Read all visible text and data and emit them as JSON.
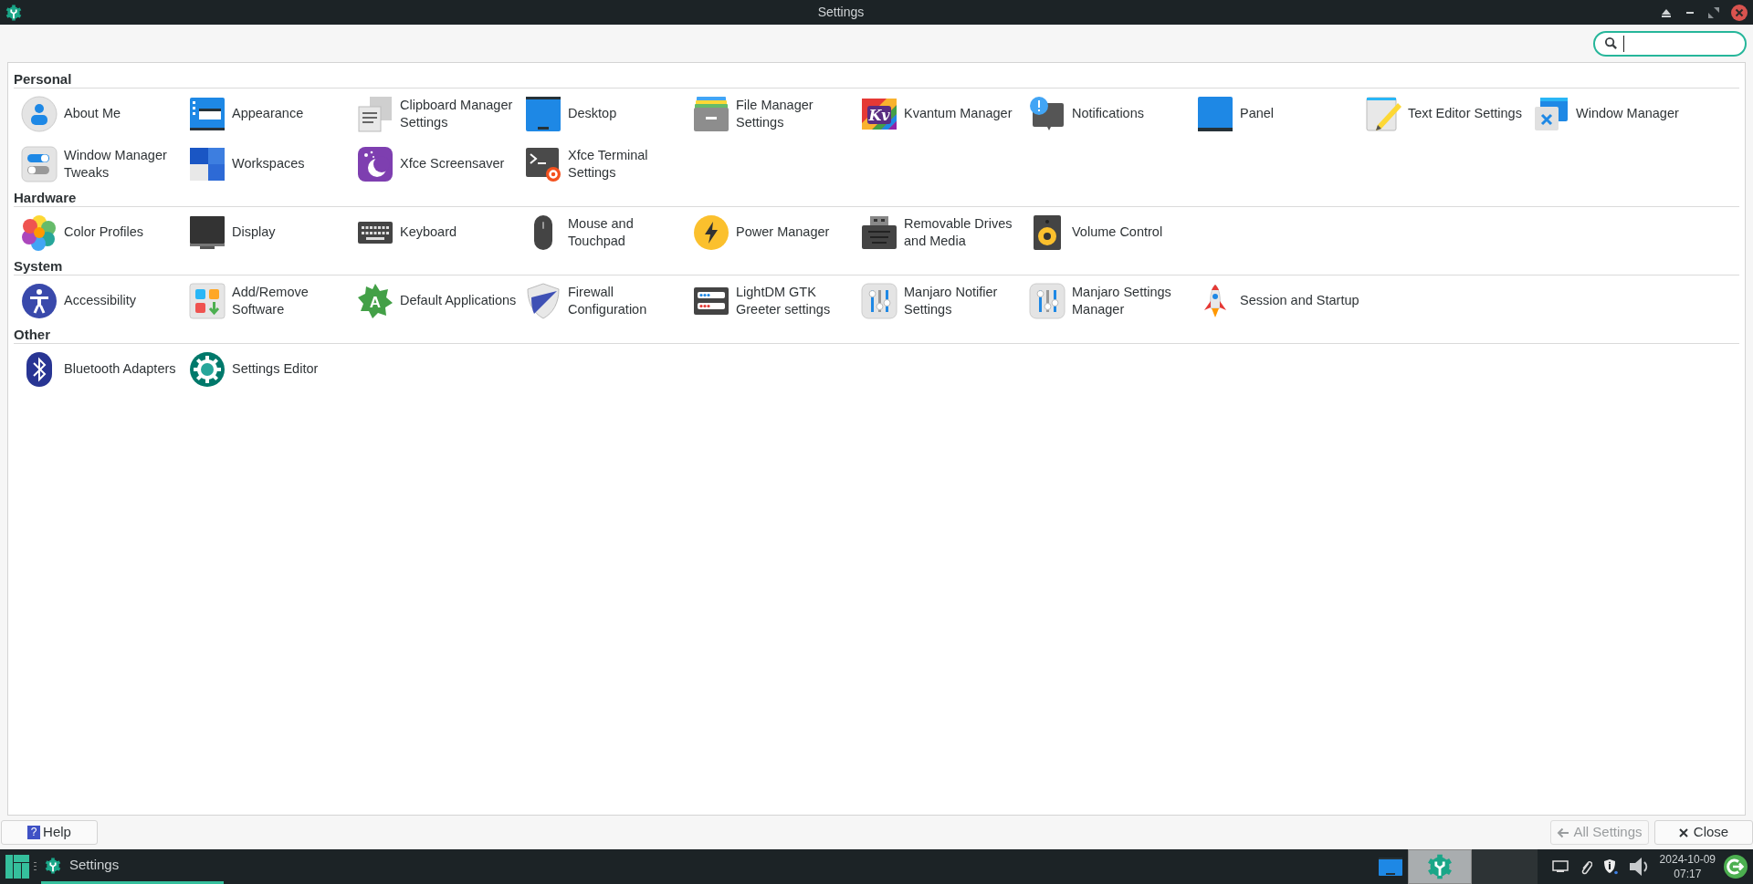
{
  "window": {
    "title": "Settings"
  },
  "search": {
    "focused": true
  },
  "sections": [
    {
      "title": "Personal",
      "items": [
        {
          "label": "About Me",
          "kind": "person"
        },
        {
          "label": "Appearance",
          "kind": "appearance"
        },
        {
          "label": "Clipboard Manager Settings",
          "kind": "clipboard"
        },
        {
          "label": "Desktop",
          "kind": "desktop"
        },
        {
          "label": "File Manager Settings",
          "kind": "filemanager"
        },
        {
          "label": "Kvantum Manager",
          "kind": "kvantum",
          "icon_text": "Kv"
        },
        {
          "label": "Notifications",
          "kind": "notification"
        },
        {
          "label": "Panel",
          "kind": "panel"
        },
        {
          "label": "Text Editor Settings",
          "kind": "texteditor"
        },
        {
          "label": "Window Manager",
          "kind": "windowmanager"
        },
        {
          "label": "Window Manager Tweaks",
          "kind": "toggles"
        },
        {
          "label": "Workspaces",
          "kind": "workspaces"
        },
        {
          "label": "Xfce Screensaver",
          "kind": "moon"
        },
        {
          "label": "Xfce Terminal Settings",
          "kind": "terminal"
        }
      ]
    },
    {
      "title": "Hardware",
      "items": [
        {
          "label": "Color Profiles",
          "kind": "colors"
        },
        {
          "label": "Display",
          "kind": "display"
        },
        {
          "label": "Keyboard",
          "kind": "keyboard"
        },
        {
          "label": "Mouse and Touchpad",
          "kind": "mouse"
        },
        {
          "label": "Power Manager",
          "kind": "power"
        },
        {
          "label": "Removable Drives and Media",
          "kind": "usb"
        },
        {
          "label": "Volume Control",
          "kind": "speaker"
        }
      ]
    },
    {
      "title": "System",
      "items": [
        {
          "label": "Accessibility",
          "kind": "accessibility"
        },
        {
          "label": "Add/Remove Software",
          "kind": "software"
        },
        {
          "label": "Default Applications",
          "kind": "defaultapps",
          "icon_text": "A"
        },
        {
          "label": "Firewall Configuration",
          "kind": "shield"
        },
        {
          "label": "LightDM GTK Greeter settings",
          "kind": "greeter"
        },
        {
          "label": "Manjaro Notifier Settings",
          "kind": "sliders"
        },
        {
          "label": "Manjaro Settings Manager",
          "kind": "sliders"
        },
        {
          "label": "Session and Startup",
          "kind": "rocket"
        }
      ]
    },
    {
      "title": "Other",
      "items": [
        {
          "label": "Bluetooth Adapters",
          "kind": "bluetooth"
        },
        {
          "label": "Settings Editor",
          "kind": "gear"
        }
      ]
    }
  ],
  "buttons": {
    "help": {
      "label": "Help",
      "icon_text": "?"
    },
    "all_settings": {
      "label": "All Settings",
      "disabled": true
    },
    "close": {
      "label": "Close"
    }
  },
  "taskbar": {
    "task": {
      "label": "Settings",
      "selected": true
    },
    "date": "2024-10-09",
    "time": "07:17"
  }
}
